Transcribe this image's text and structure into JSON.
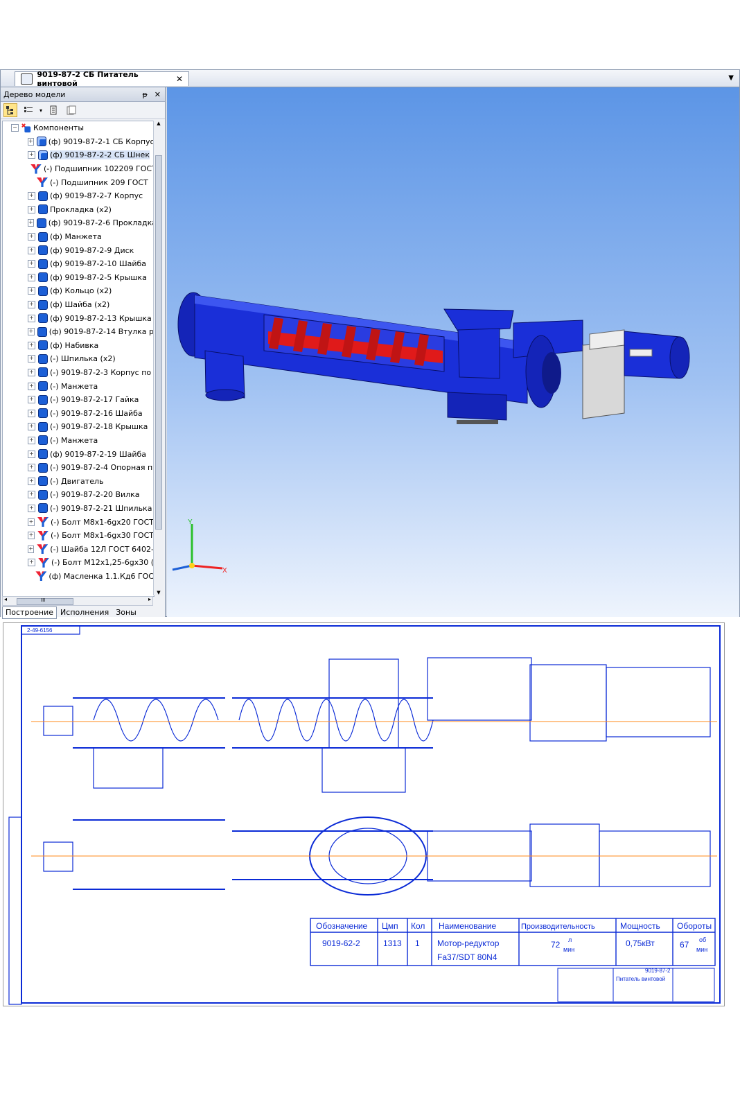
{
  "document_tab": {
    "title": "9019-87-2 СБ Питатель винтовой",
    "close": "✕"
  },
  "tree_panel": {
    "title": "Дерево модели",
    "pin": "ᵽ",
    "close": "✕",
    "root_label": "Компоненты",
    "items": [
      {
        "label": "(ф) 9019-87-2-1 СБ Корпус",
        "icon": "assembly-icon"
      },
      {
        "label": "(ф) 9019-87-2-2 СБ Шнек",
        "icon": "assembly-icon"
      },
      {
        "label": "(-) Подшипник 102209 ГОСТ",
        "icon": "standard-part-icon"
      },
      {
        "label": "(-) Подшипник 209 ГОСТ",
        "icon": "standard-part-icon"
      },
      {
        "label": "(ф) 9019-87-2-7 Корпус",
        "icon": "part-icon"
      },
      {
        "label": "Прокладка (x2)",
        "icon": "part-icon"
      },
      {
        "label": "(ф) 9019-87-2-6 Прокладка",
        "icon": "part-icon"
      },
      {
        "label": "(ф)    Манжета",
        "icon": "part-icon"
      },
      {
        "label": "(ф) 9019-87-2-9 Диск",
        "icon": "part-icon"
      },
      {
        "label": "(ф) 9019-87-2-10 Шайба",
        "icon": "part-icon"
      },
      {
        "label": "(ф) 9019-87-2-5 Крышка",
        "icon": "part-icon"
      },
      {
        "label": "(ф) Кольцо (x2)",
        "icon": "part-icon"
      },
      {
        "label": "(ф) Шайба (x2)",
        "icon": "part-icon"
      },
      {
        "label": "(ф) 9019-87-2-13 Крышка",
        "icon": "part-icon"
      },
      {
        "label": "(ф) 9019-87-2-14 Втулка р",
        "icon": "part-icon"
      },
      {
        "label": "(ф)      Набивка",
        "icon": "part-icon"
      },
      {
        "label": "(-) Шпилька (x2)",
        "icon": "part-icon"
      },
      {
        "label": "(-) 9019-87-2-3 Корпус по",
        "icon": "part-icon"
      },
      {
        "label": "(-)      Манжета",
        "icon": "part-icon"
      },
      {
        "label": "(-) 9019-87-2-17 Гайка",
        "icon": "part-icon"
      },
      {
        "label": "(-) 9019-87-2-16 Шайба",
        "icon": "part-icon"
      },
      {
        "label": "(-) 9019-87-2-18 Крышка",
        "icon": "part-icon"
      },
      {
        "label": "(-)      Манжета",
        "icon": "part-icon"
      },
      {
        "label": "(ф) 9019-87-2-19 Шайба",
        "icon": "part-icon"
      },
      {
        "label": "(-) 9019-87-2-4 Опорная п",
        "icon": "part-icon"
      },
      {
        "label": "(-) Двигатель",
        "icon": "part-icon"
      },
      {
        "label": "(-) 9019-87-2-20 Вилка",
        "icon": "part-icon"
      },
      {
        "label": "(-) 9019-87-2-21 Шпилька",
        "icon": "part-icon"
      },
      {
        "label": "(-) Болт М8x1-6gx20 ГОСТ",
        "icon": "standard-part-icon"
      },
      {
        "label": "(-) Болт М8x1-6gx30 ГОСТ",
        "icon": "standard-part-icon"
      },
      {
        "label": "(-) Шайба 12Л ГОСТ 6402-",
        "icon": "standard-part-icon"
      },
      {
        "label": "(-) Болт М12x1,25-6gx30 (",
        "icon": "standard-part-icon"
      },
      {
        "label": "(ф) Масленка 1.1.Кд6 ГОС",
        "icon": "standard-part-icon"
      }
    ],
    "scroll_grip": "III",
    "bottom_tabs": [
      "Построение",
      "Исполнения",
      "Зоны"
    ]
  },
  "viewport": {
    "axis_y": "Y",
    "axis_x": "X"
  },
  "drawing": {
    "table_headers": [
      "Обозначение",
      "Цмп",
      "Кол",
      "Наименование",
      "Производительность",
      "Мощность",
      "Обороты"
    ],
    "table_row": {
      "designation": "9019-62-2",
      "code": "1313",
      "qty": "1",
      "name_line1": "Мотор-редуктор",
      "name_line2": "Fa37/SDT 80N4",
      "productivity": "72",
      "productivity_unit_top": "л",
      "productivity_unit_bottom": "мин",
      "power": "0,75кВт",
      "speed": "67",
      "speed_unit_top": "об",
      "speed_unit_bottom": "мин"
    },
    "stamp_code": "9019-87-2",
    "stamp_title": "Питатель винтовой",
    "corner_code": "2-49-6156"
  },
  "colors": {
    "drawing_blue": "#0a2ad6",
    "model_blue": "#1a2fd8",
    "screw_red": "#e01a1a",
    "axis_orange": "#ff8a1a"
  }
}
